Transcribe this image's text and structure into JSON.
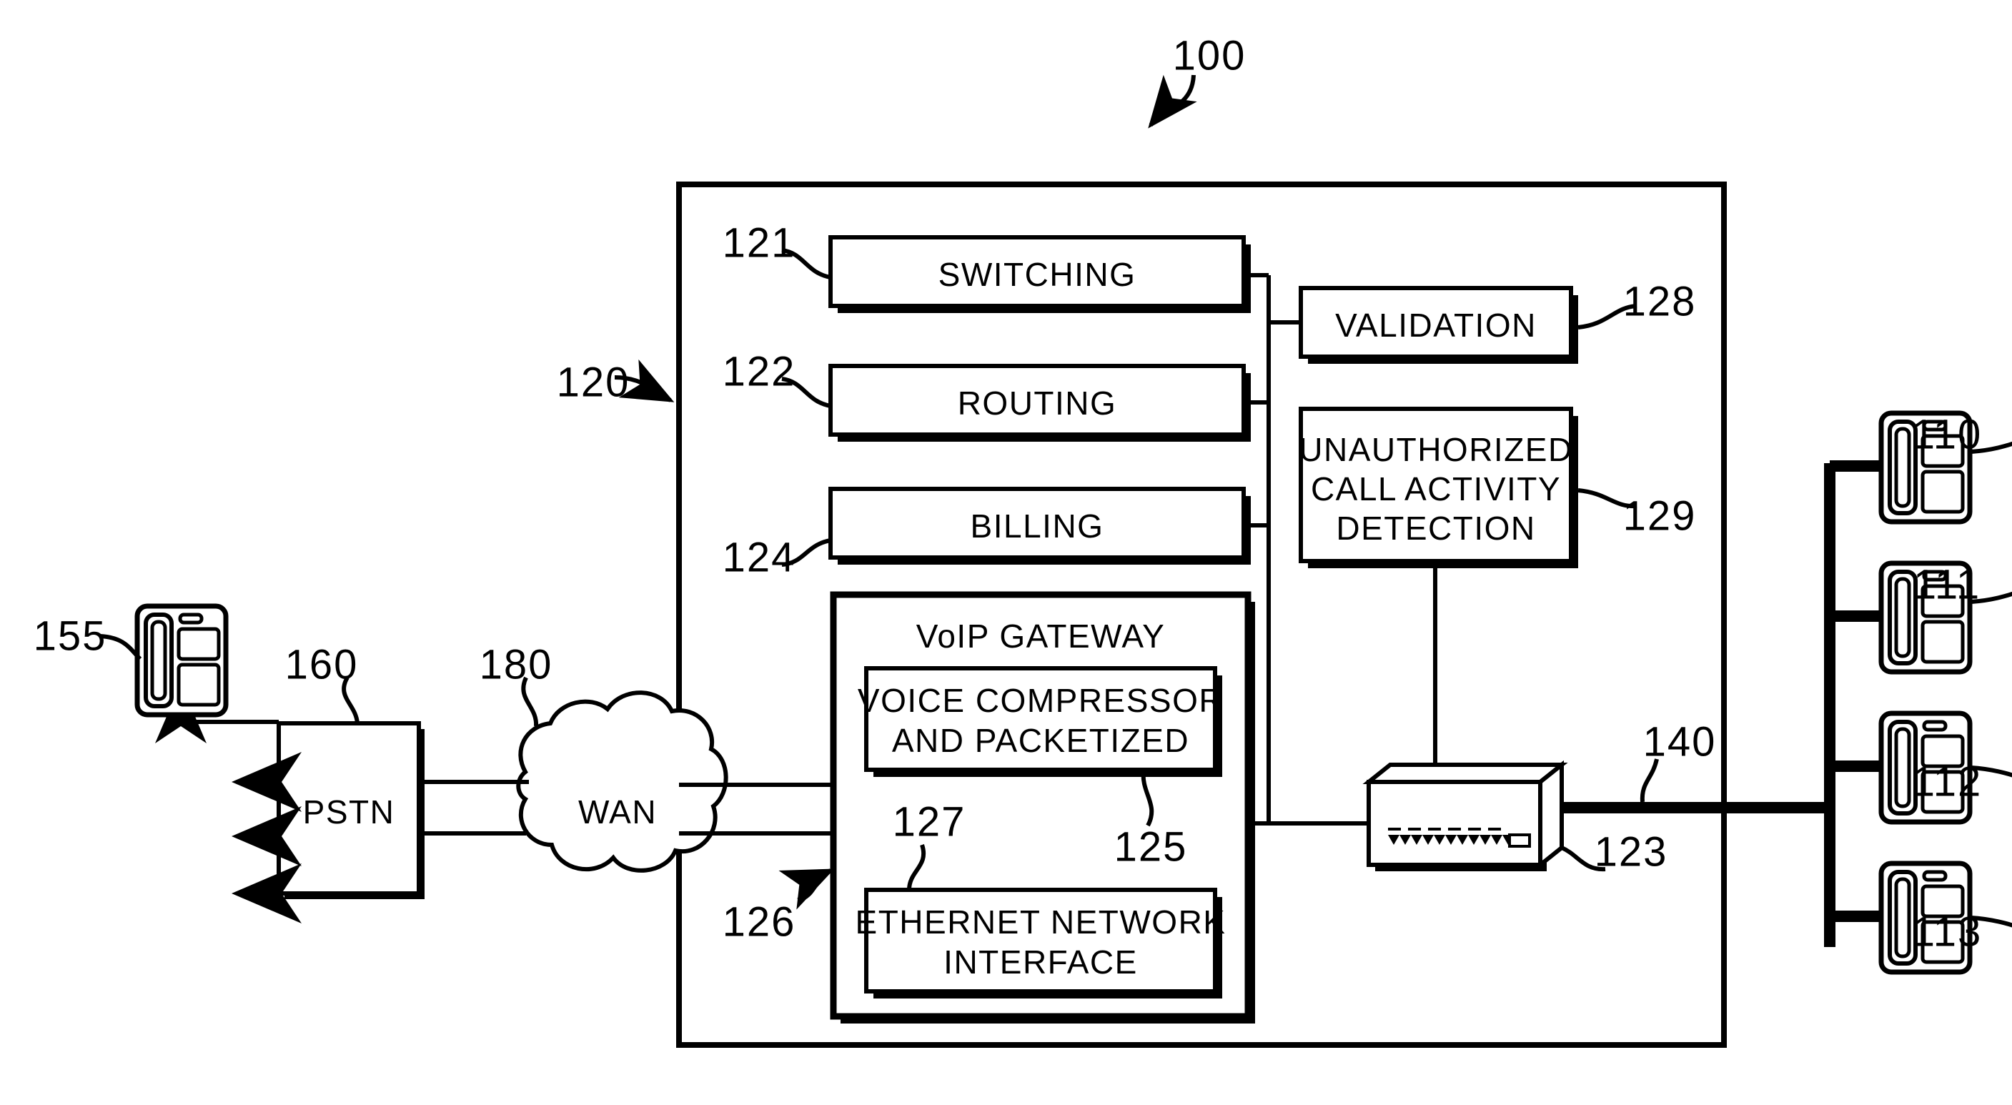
{
  "figure": {
    "type": "patent-block-diagram",
    "title_ref": "100"
  },
  "refs": {
    "system": "100",
    "pbx_system": "120",
    "switching": "121",
    "routing": "122",
    "network_switch": "123",
    "billing": "124",
    "voice_compressor": "125",
    "voip_gateway": "126",
    "ethernet_interface": "127",
    "validation": "128",
    "unauthorized_detection": "129",
    "ip_phone_1": "110",
    "ip_phone_2": "111",
    "ip_phone_3": "112",
    "ip_phone_4": "113",
    "lan_bus": "140",
    "external_phone": "155",
    "pstn": "160",
    "wan": "180"
  },
  "blocks": {
    "switching": {
      "label": "SWITCHING"
    },
    "routing": {
      "label": "ROUTING"
    },
    "billing": {
      "label": "BILLING"
    },
    "validation": {
      "label": "VALIDATION"
    },
    "detection": {
      "label_line1": "UNAUTHORIZED",
      "label_line2": "CALL ACTIVITY",
      "label_line3": "DETECTION"
    },
    "voip_gateway": {
      "label": "VoIP GATEWAY"
    },
    "voice_compressor": {
      "label_line1": "VOICE COMPRESSOR",
      "label_line2": "AND PACKETIZED"
    },
    "ethernet_interface": {
      "label_line1": "ETHERNET NETWORK",
      "label_line2": "INTERFACE"
    },
    "pstn": {
      "label": "PSTN"
    },
    "wan": {
      "label": "WAN"
    }
  },
  "icons": {
    "ip_phone": "desk-phone-icon",
    "network_switch": "network-switch-icon",
    "cloud": "cloud-icon"
  },
  "colors": {
    "ink": "#000000",
    "paper": "#ffffff"
  }
}
